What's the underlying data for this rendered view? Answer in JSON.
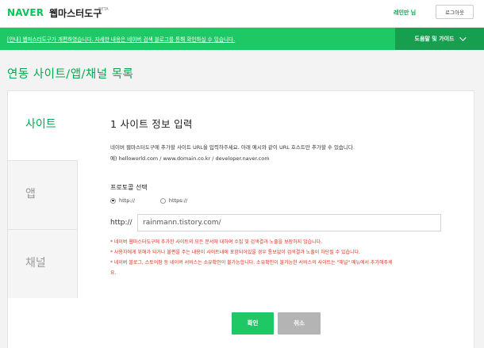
{
  "header": {
    "logo": "NAVER",
    "title": "웹마스터도구",
    "beta": "BETA",
    "user": "레인만 님",
    "logout_label": "로그아웃"
  },
  "notice": {
    "text": "[안내] 웹마스터도구가 개편하였습니다. 자세한 내용은 네이버 검색 블로그를 통해 확인하실 수 있습니다.",
    "help_label": "도움말 및 가이드"
  },
  "page_title": "연동 사이트/앱/채널 목록",
  "sidebar": {
    "items": [
      {
        "label": "사이트",
        "active": true
      },
      {
        "label": "앱",
        "active": false
      },
      {
        "label": "채널",
        "active": false
      }
    ]
  },
  "form": {
    "title": "1 사이트 정보 입력",
    "desc1": "네이버 웹마스터도구에 추가할 사이트 URL을 입력하주세요. 아래 예시와 같이 URL 호스트만 추가할 수 있습니다.",
    "desc2": "예) helloworld.com / www.domain.co.kr / developer.naver.com",
    "protocol_title": "프로토콜 선택",
    "protocol_options": [
      "http://",
      "https://"
    ],
    "selected_protocol": "http://",
    "url_prefix": "http://",
    "url_value": "rainmann.tistory.com/",
    "notes": [
      "* 네이버 웹마스터도구에 추가한 사이트의 모든 문서에 대하여 수집 및 검색결과 노출을 보장하지 않습니다.",
      "* 사용자에게 위해가 되거나 불편을 주는 내용이 사이트내에 포함되어있을 경우 통보없이 검색결과 노출이 차단될 수 있습니다.",
      "* 네이버 블로그, 스토어팜 등 네이버 서비스는 소유확인이 불가능합니다. 소유확인이 불가능한 서비스의 사이트는 \"채널\" 메뉴에서 추가해주세",
      "요."
    ],
    "ok_label": "확인",
    "cancel_label": "취소"
  }
}
